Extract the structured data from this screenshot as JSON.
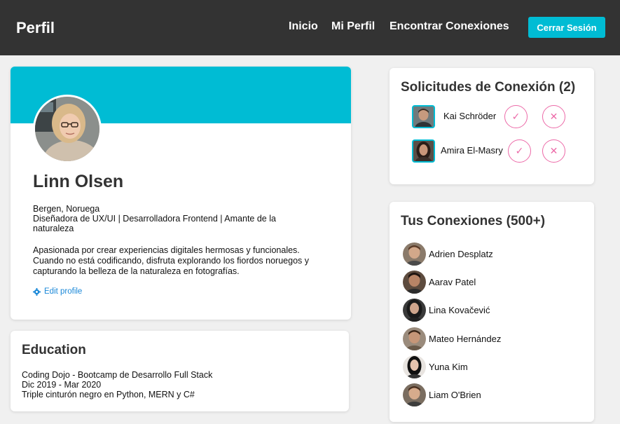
{
  "header": {
    "brand": "Perfil",
    "nav": [
      "Inicio",
      "Mi Perfil",
      "Encontrar Conexiones"
    ],
    "logout_label": "Cerrar Sesión",
    "accent_color": "#00bcd4",
    "bar_color": "#333333"
  },
  "profile": {
    "name": "Linn Olsen",
    "location": "Bergen, Noruega",
    "headline": "Diseñadora de UX/UI | Desarrolladora Frontend | Amante de la naturaleza",
    "bio": "Apasionada por crear experiencias digitales hermosas y funcionales. Cuando no está codificando, disfruta explorando los fiordos noruegos y capturando la belleza de la naturaleza en fotografías.",
    "edit_label": "Edit profile"
  },
  "education": {
    "title": "Education",
    "program": "Coding Dojo - Bootcamp de Desarrollo Full Stack",
    "dates": "Dic 2019 - Mar 2020",
    "note": "Triple cinturón negro en Python, MERN y C#"
  },
  "requests": {
    "title": "Solicitudes de Conexión (2)",
    "items": [
      {
        "name": "Kai Schröder",
        "accept_icon": "✓",
        "reject_icon": "✕"
      },
      {
        "name": "Amira El-Masry",
        "accept_icon": "✓",
        "reject_icon": "✕"
      }
    ],
    "button_color": "#ec6aa8"
  },
  "connections": {
    "title": "Tus Conexiones (500+)",
    "items": [
      {
        "name": "Adrien Desplatz"
      },
      {
        "name": "Aarav Patel"
      },
      {
        "name": "Lina Kovačević"
      },
      {
        "name": "Mateo Hernández"
      },
      {
        "name": "Yuna Kim"
      },
      {
        "name": "Liam O'Brien"
      }
    ]
  }
}
